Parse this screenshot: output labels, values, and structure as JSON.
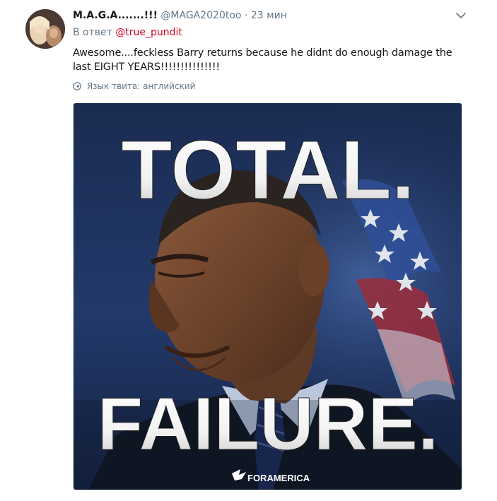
{
  "tweet": {
    "display_name": "M.A.G.A.......!!!",
    "handle": "@MAGA2020too",
    "separator": "·",
    "time": "23 мин",
    "reply_prefix": "В ответ",
    "reply_to": "@true_pundit",
    "text": "Awesome....feckless Barry returns because he didnt do enough damage the last EIGHT YEARS!!!!!!!!!!!!!!!",
    "language_label": "Язык твита: английский"
  },
  "media": {
    "headline_top": "TOTAL.",
    "headline_bottom": "FAILURE.",
    "watermark": "FORAMERICA"
  },
  "colors": {
    "text_primary": "#14171a",
    "text_secondary": "#657786",
    "mention": "#d0021b",
    "border": "#e1e8ed"
  },
  "icons": {
    "menu": "chevron-down-icon",
    "language": "globe-icon",
    "watermark_logo": "eagle-icon"
  }
}
